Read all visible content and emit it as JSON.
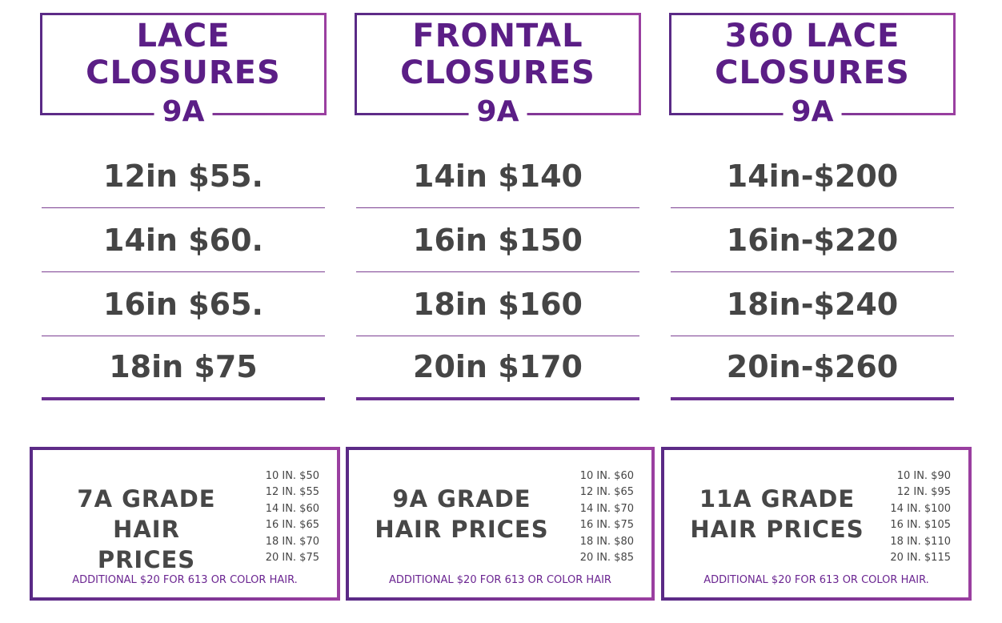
{
  "closures": [
    {
      "title_line1": "LACE",
      "title_line2": "CLOSURES",
      "grade": "9A",
      "prices": [
        "12in $55.",
        "14in $60.",
        "16in $65.",
        "18in $75"
      ]
    },
    {
      "title_line1": "FRONTAL",
      "title_line2": "CLOSURES",
      "grade": "9A",
      "prices": [
        "14in $140",
        "16in $150",
        "18in $160",
        "20in $170"
      ]
    },
    {
      "title_line1": "360 LACE",
      "title_line2": "CLOSURES",
      "grade": "9A",
      "prices": [
        "14in-$200",
        "16in-$220",
        "18in-$240",
        "20in-$260"
      ]
    }
  ],
  "grades": [
    {
      "title_line1": "7A GRADE HAIR",
      "title_line2": "PRICES",
      "prices": [
        "10 IN. $50",
        "12 IN. $55",
        "14 IN. $60",
        "16 IN. $65",
        "18 IN. $70",
        "20 IN. $75"
      ],
      "note": "ADDITIONAL $20 FOR 613 OR COLOR HAIR."
    },
    {
      "title_line1": "9A GRADE",
      "title_line2": "HAIR PRICES",
      "prices": [
        "10 IN. $60",
        "12 IN. $65",
        "14 IN. $70",
        "16 IN. $75",
        "18 IN. $80",
        "20 IN. $85"
      ],
      "note": "ADDITIONAL $20 FOR 613 OR COLOR HAIR"
    },
    {
      "title_line1": "11A GRADE",
      "title_line2": "HAIR PRICES",
      "prices": [
        "10 IN. $90",
        "12 IN. $95",
        "14 IN. $100",
        "16 IN. $105",
        "18 IN. $110",
        "20 IN. $115"
      ],
      "note": "ADDITIONAL $20 FOR 613 OR COLOR HAIR."
    }
  ]
}
